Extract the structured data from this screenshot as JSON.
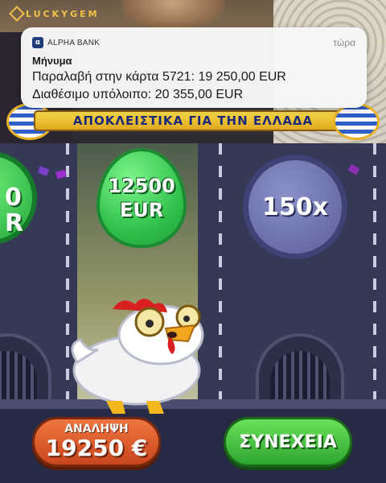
{
  "stream": {
    "brand": "LUCKYGEM",
    "banner": "ΑΠΟΚΛΕΙΣΤΙΚΑ ΓΙΑ ΤΗΝ ΕΛΛΑΔΑ"
  },
  "notification": {
    "app_name": "ALPHA BANK",
    "time": "τώρα",
    "title": "Μήνυμα",
    "line1": "Παραλαβή στην κάρτα 5721: 19 250,00 EUR",
    "line2": "Διαθέσιμο υπόλοιπο: 20 355,00 EUR"
  },
  "game": {
    "left_coin_line1": "0",
    "left_coin_line2": "R",
    "egg_amount": "12500",
    "egg_currency": "EUR",
    "multiplier": "150x",
    "withdraw_label": "ΑΝΑΛΗΨΗ",
    "withdraw_amount": "19250 €",
    "continue_label": "ΣΥΝΕΧΕΙΑ"
  },
  "colors": {
    "notification_bg": "#f6f6f6",
    "banner_yellow": "#f7d84a",
    "banner_text": "#1b2a78",
    "egg_green": "#2fc04a",
    "withdraw_orange": "#e0602e",
    "continue_green": "#3fbf3a",
    "game_bg": "#353955"
  },
  "icons": {
    "bank_logo": "alpha-bank-logo-icon",
    "brand": "luckygem-logo-icon"
  }
}
